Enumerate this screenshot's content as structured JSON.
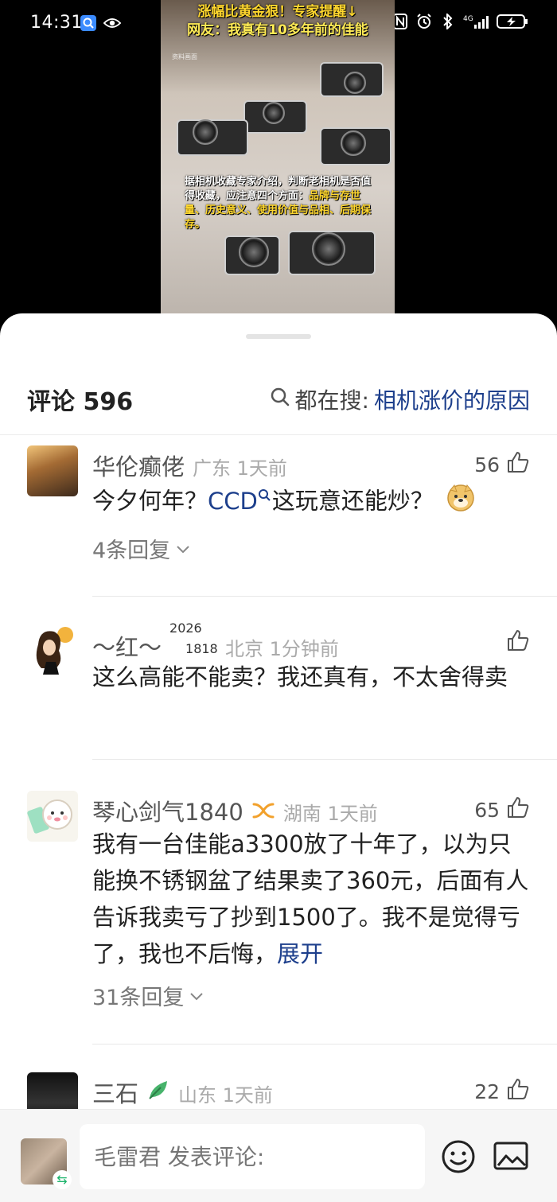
{
  "status_bar": {
    "time": "14:31"
  },
  "video": {
    "headline_line1": "涨幅比黄金狠！专家提醒↓",
    "headline_line2": "网友：我真有10多年前的佳能",
    "caption_part1": "据相机收藏专家介绍，判断老相机是否值得收藏，应注意四个方面：",
    "caption_part2": "品牌与存世量、历史意义、使用价值与品相、后期保存。",
    "small_label": "资料画面"
  },
  "header": {
    "comment_count": "评论 596",
    "search_prefix": "都在搜:",
    "search_keyword": "相机涨价的原因"
  },
  "comments": [
    {
      "name": "华伦癫佬",
      "location": "广东 1天前",
      "likes": "56",
      "text_before": "今夕何年？",
      "link": "CCD",
      "text_after": "这玩意还能炒？",
      "replies": "4条回复"
    },
    {
      "name": "～红～",
      "badge_sup": "2026",
      "badge_sub": "1818",
      "location": "北京 1分钟前",
      "likes": "",
      "text": "这么高能不能卖？我还真有，不太舍得卖"
    },
    {
      "name": "琴心剑气1840",
      "location": "湖南 1天前",
      "likes": "65",
      "text": "我有一台佳能a3300放了十年了，以为只能换不锈钢盆了结果卖了360元，后面有人告诉我卖亏了抄到1500了。我不是觉得亏了，我也不后悔，",
      "expand": "展开",
      "replies": "31条回复"
    },
    {
      "name": "三石",
      "location": "山东 1天前",
      "likes": "22"
    }
  ],
  "bottom": {
    "input_placeholder": "毛雷君 发表评论:"
  }
}
